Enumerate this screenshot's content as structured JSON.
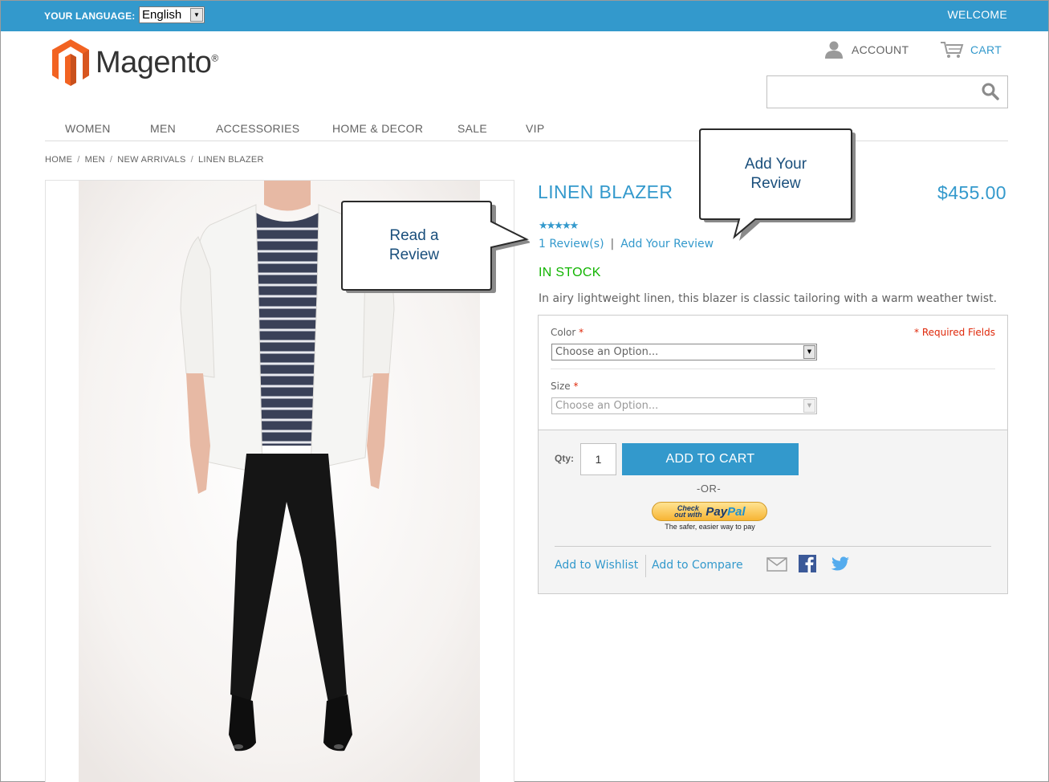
{
  "topbar": {
    "language_label": "YOUR LANGUAGE:",
    "language_value": "English",
    "welcome": "WELCOME"
  },
  "header": {
    "logo_text": "Magento",
    "logo_mark": "®",
    "account_label": "ACCOUNT",
    "cart_label": "CART",
    "search_placeholder": ""
  },
  "nav": {
    "items": [
      "WOMEN",
      "MEN",
      "ACCESSORIES",
      "HOME & DECOR",
      "SALE",
      "VIP"
    ]
  },
  "breadcrumb": {
    "items": [
      "HOME",
      "MEN",
      "NEW ARRIVALS",
      "LINEN BLAZER"
    ],
    "separator": "/"
  },
  "product": {
    "name": "LINEN BLAZER",
    "price": "$455.00",
    "rating": 5,
    "rating_stars": "★★★★★",
    "reviews_link": "1 Review(s)",
    "reviews_separator": "|",
    "add_review_link": "Add Your Review",
    "stock": "IN STOCK",
    "description": "In airy lightweight linen, this blazer is classic tailoring with a warm weather twist."
  },
  "options": {
    "required_note": "* Required Fields",
    "required_mark": "*",
    "color_label": "Color",
    "color_value": "Choose an Option...",
    "size_label": "Size",
    "size_value": "Choose an Option..."
  },
  "cart": {
    "qty_label": "Qty:",
    "qty_value": "1",
    "add_to_cart": "ADD TO CART",
    "or": "-OR-",
    "paypal_checkout": "Check out with",
    "paypal_brand_a": "Pay",
    "paypal_brand_b": "Pal",
    "paypal_tagline": "The safer, easier way to pay",
    "wishlist": "Add to Wishlist",
    "compare": "Add to Compare"
  },
  "callouts": {
    "read_review": [
      "Read a",
      "Review"
    ],
    "add_review": [
      "Add Your",
      "Review"
    ]
  },
  "colors": {
    "accent": "#3399cc",
    "in_stock": "#11b400",
    "required": "#df280a",
    "logo_orange": "#f26322",
    "callout_text": "#1a4f7c"
  },
  "icons": {
    "account": "user-icon",
    "cart": "cart-icon",
    "search": "search-icon",
    "email": "email-icon",
    "facebook": "facebook-icon",
    "twitter": "twitter-icon"
  }
}
